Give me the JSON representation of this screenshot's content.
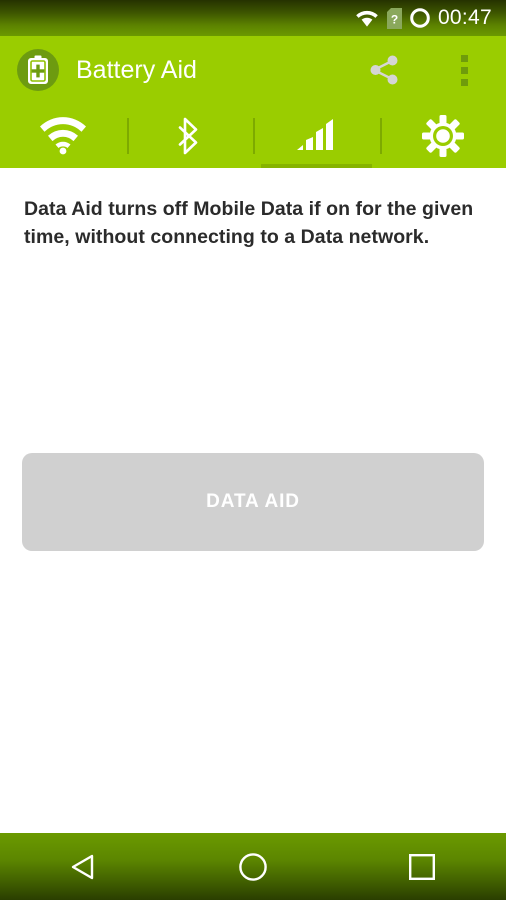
{
  "statusbar": {
    "clock": "00:47",
    "icons": [
      "wifi-icon",
      "sim-question-icon",
      "battery-circle-icon"
    ],
    "gradient_top": "#253200",
    "gradient_bottom": "#6b9a00"
  },
  "actionbar": {
    "app_icon": "battery-plus-icon",
    "title": "Battery Aid",
    "share_icon": "share-icon",
    "overflow_icon": "overflow-menu-icon",
    "background": "#9acd00"
  },
  "tabs": [
    {
      "icon": "wifi-icon",
      "label": "Wifi",
      "selected": false
    },
    {
      "icon": "bluetooth-icon",
      "label": "Bluetooth",
      "selected": false
    },
    {
      "icon": "signal-icon",
      "label": "Data",
      "selected": true
    },
    {
      "icon": "gear-icon",
      "label": "Settings",
      "selected": false
    }
  ],
  "tab_indicator_color": "#86b300",
  "content": {
    "description": "Data Aid turns off Mobile Data if on for the given time, without connecting to a Data network.",
    "action_button": {
      "label": "DATA AID",
      "enabled": false,
      "background": "#d0d0d0",
      "text_color": "#ffffff"
    }
  },
  "navbar": {
    "buttons": [
      {
        "icon": "back-triangle-icon",
        "label": "Back"
      },
      {
        "icon": "home-circle-icon",
        "label": "Home"
      },
      {
        "icon": "recents-square-icon",
        "label": "Recents"
      }
    ]
  }
}
